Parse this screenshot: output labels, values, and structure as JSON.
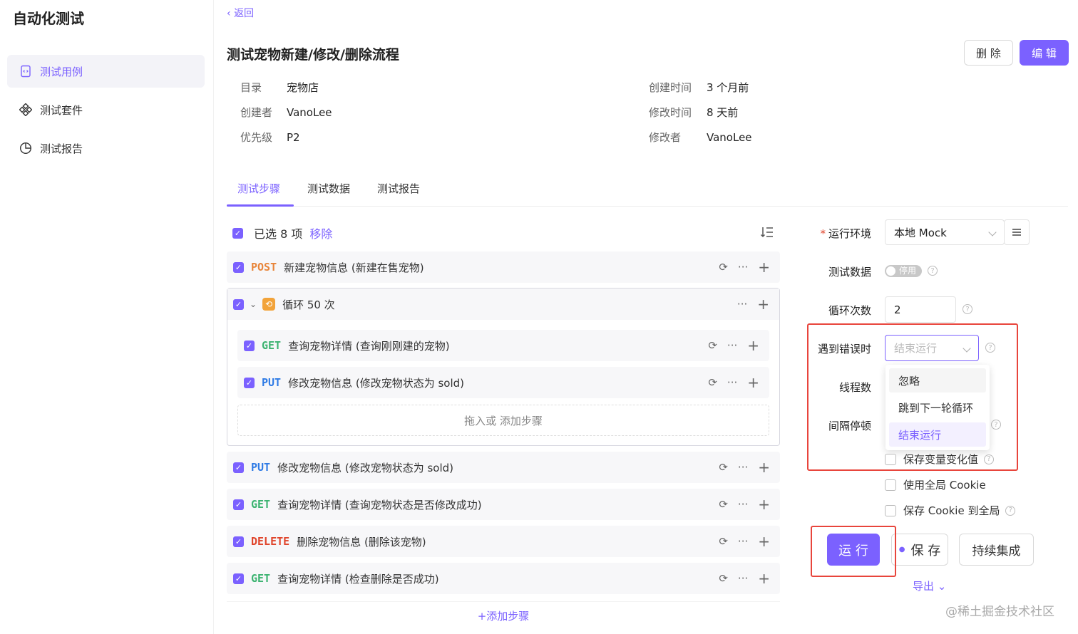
{
  "app": {
    "title": "自动化测试"
  },
  "sidebar": {
    "items": [
      {
        "label": "测试用例",
        "icon": "doc-icon",
        "active": true
      },
      {
        "label": "测试套件",
        "icon": "grid-icon",
        "active": false
      },
      {
        "label": "测试报告",
        "icon": "pie-chart-icon",
        "active": false
      }
    ]
  },
  "header": {
    "back_label": "返回",
    "title": "测试宠物新建/修改/删除流程",
    "delete_label": "删 除",
    "edit_label": "编 辑"
  },
  "meta": {
    "dir_key": "目录",
    "dir_val": "宠物店",
    "creator_key": "创建者",
    "creator_val": "VanoLee",
    "priority_key": "优先级",
    "priority_val": "P2",
    "created_key": "创建时间",
    "created_val": "3 个月前",
    "modified_key": "修改时间",
    "modified_val": "8 天前",
    "modifier_key": "修改者",
    "modifier_val": "VanoLee"
  },
  "tabs": [
    "测试步骤",
    "测试数据",
    "测试报告"
  ],
  "selection": {
    "text": "已选 8 项",
    "remove_label": "移除"
  },
  "steps": {
    "s1": {
      "method": "POST",
      "name": "新建宠物信息 (新建在售宠物)"
    },
    "loop": {
      "label": "循环 50 次"
    },
    "s2": {
      "method": "GET",
      "name": "查询宠物详情 (查询刚刚建的宠物)"
    },
    "s3": {
      "method": "PUT",
      "name": "修改宠物信息 (修改宠物状态为 sold)"
    },
    "drop_label": "拖入或 添加步骤",
    "s4": {
      "method": "PUT",
      "name": "修改宠物信息 (修改宠物状态为 sold)"
    },
    "s5": {
      "method": "GET",
      "name": "查询宠物详情 (查询宠物状态是否修改成功)"
    },
    "s6": {
      "method": "DELETE",
      "name": "删除宠物信息 (删除该宠物)"
    },
    "s7": {
      "method": "GET",
      "name": "查询宠物详情 (检查删除是否成功)"
    },
    "add_label": "+添加步骤"
  },
  "config": {
    "env_label": "运行环境",
    "env_value": "本地 Mock",
    "data_label": "测试数据",
    "data_toggle": "停用",
    "loop_label": "循环次数",
    "loop_value": "2",
    "error_label": "遇到错误时",
    "error_placeholder": "结束运行",
    "threads_label": "线程数",
    "interval_label": "间隔停顿",
    "error_options": [
      "忽略",
      "跳到下一轮循环",
      "结束运行"
    ],
    "cb_save_var": "保存变量变化值",
    "cb_global_cookie": "使用全局 Cookie",
    "cb_save_cookie": "保存 Cookie 到全局"
  },
  "actions": {
    "run_label": "运 行",
    "save_label": "保 存",
    "ci_label": "持续集成",
    "export_label": "导出"
  },
  "watermark": "@稀土掘金技术社区",
  "colors": {
    "accent": "#7b61ff",
    "post": "#e8853a",
    "get": "#3cb371",
    "put": "#2f7be5",
    "delete": "#e0452c",
    "highlight": "#e8453c"
  }
}
